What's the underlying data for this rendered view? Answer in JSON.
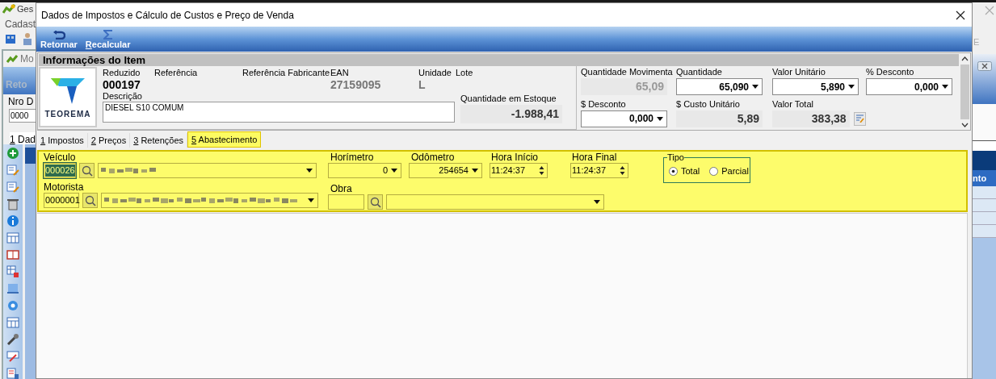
{
  "background_window": {
    "title": "Ges",
    "menu_item": "Cadast",
    "subwindow_title": "Mo",
    "toolbar_button": "Reto",
    "field_label": "Nro D",
    "field_value": "0000",
    "tab": "1 Dad",
    "menu_fragment": "E",
    "column_header": "nto"
  },
  "dialog": {
    "title": "Dados de Impostos e Cálculo de Custos e Preço de Venda",
    "toolbar": [
      {
        "kind": "return",
        "label": "Retornar",
        "mnemonic": false
      },
      {
        "kind": "sigma",
        "label": "Recalcular",
        "mnemonic": true
      }
    ],
    "item_info": {
      "header": "Informações do Item",
      "logo_text": "TEOREMA",
      "reduzido": {
        "label": "Reduzido",
        "value": "000197"
      },
      "referencia": {
        "label": "Referência"
      },
      "referencia_fabricante": {
        "label": "Referência Fabricante"
      },
      "ean": {
        "label": "EAN",
        "value": "27159095"
      },
      "unidade": {
        "label": "Unidade",
        "value": "L"
      },
      "lote": {
        "label": "Lote"
      },
      "descricao": {
        "label": "Descrição",
        "value": "DIESEL S10 COMUM"
      },
      "estoque": {
        "label": "Quantidade em Estoque",
        "value": "-1.988,41"
      },
      "amounts": [
        {
          "label": "Quantidade Movimenta",
          "value": "65,09",
          "kind": "disabled"
        },
        {
          "label": "Quantidade",
          "value": "65,090",
          "kind": "dropdown"
        },
        {
          "label": "Valor Unitário",
          "value": "5,890",
          "kind": "dropdown"
        },
        {
          "label": "% Desconto",
          "value": "0,000",
          "kind": "dropdown"
        },
        {
          "label": "$ Desconto",
          "value": "0,000",
          "kind": "dropdown"
        },
        {
          "label": "$ Custo Unitário",
          "value": "5,89",
          "kind": "readonly"
        },
        {
          "label": "Valor Total",
          "value": "383,38",
          "kind": "readonly",
          "has_button": true
        }
      ]
    },
    "tabs": [
      {
        "label": "1 Impostos",
        "selected": false
      },
      {
        "label": "2 Preços",
        "selected": false
      },
      {
        "label": "3 Retenções",
        "selected": false
      },
      {
        "label": "5 Abastecimento",
        "selected": true
      }
    ],
    "abastecimento": {
      "veiculo": {
        "label": "Veículo",
        "code": "000026",
        "code_selected": true
      },
      "motorista": {
        "label": "Motorista",
        "code": "0000001",
        "code_selected": false
      },
      "horimetro": {
        "label": "Horímetro",
        "value": "0"
      },
      "odometro": {
        "label": "Odômetro",
        "value": "254654"
      },
      "hora_inicio": {
        "label": "Hora Início",
        "value": "11:24:37"
      },
      "hora_final": {
        "label": "Hora Final",
        "value": "11:24:37"
      },
      "obra": {
        "label": "Obra"
      },
      "tipo": {
        "label": "Tipo",
        "options": [
          {
            "label": "Total",
            "selected": true
          },
          {
            "label": "Parcial",
            "selected": false
          }
        ]
      }
    }
  }
}
